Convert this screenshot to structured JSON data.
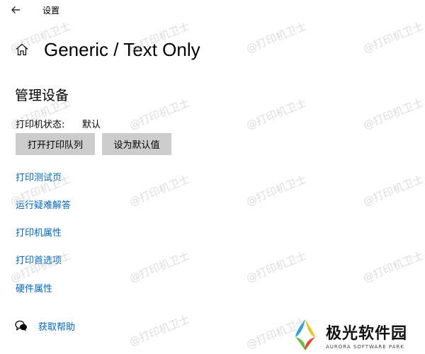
{
  "window": {
    "title": "设置"
  },
  "header": {
    "page_title": "Generic / Text Only",
    "home_icon": "home-icon",
    "back_icon": "back-arrow-icon"
  },
  "manage": {
    "section_title": "管理设备",
    "status_label": "打印机状态:",
    "status_value": "默认",
    "buttons": {
      "open_queue": "打开打印队列",
      "set_default": "设为默认值"
    }
  },
  "links": [
    {
      "label": "打印测试页"
    },
    {
      "label": "运行疑难解答"
    },
    {
      "label": "打印机属性"
    },
    {
      "label": "打印首选项"
    },
    {
      "label": "硬件属性"
    }
  ],
  "help": {
    "label": "获取帮助",
    "icon": "chat-help-icon"
  },
  "watermark": {
    "text": "@打印机卫士"
  },
  "logo": {
    "name": "极光软件园",
    "subtitle": "AURORA SOFTWARE PARK"
  },
  "colors": {
    "link": "#0067c0",
    "button_bg": "#cccccc",
    "background": "#ffffff"
  }
}
